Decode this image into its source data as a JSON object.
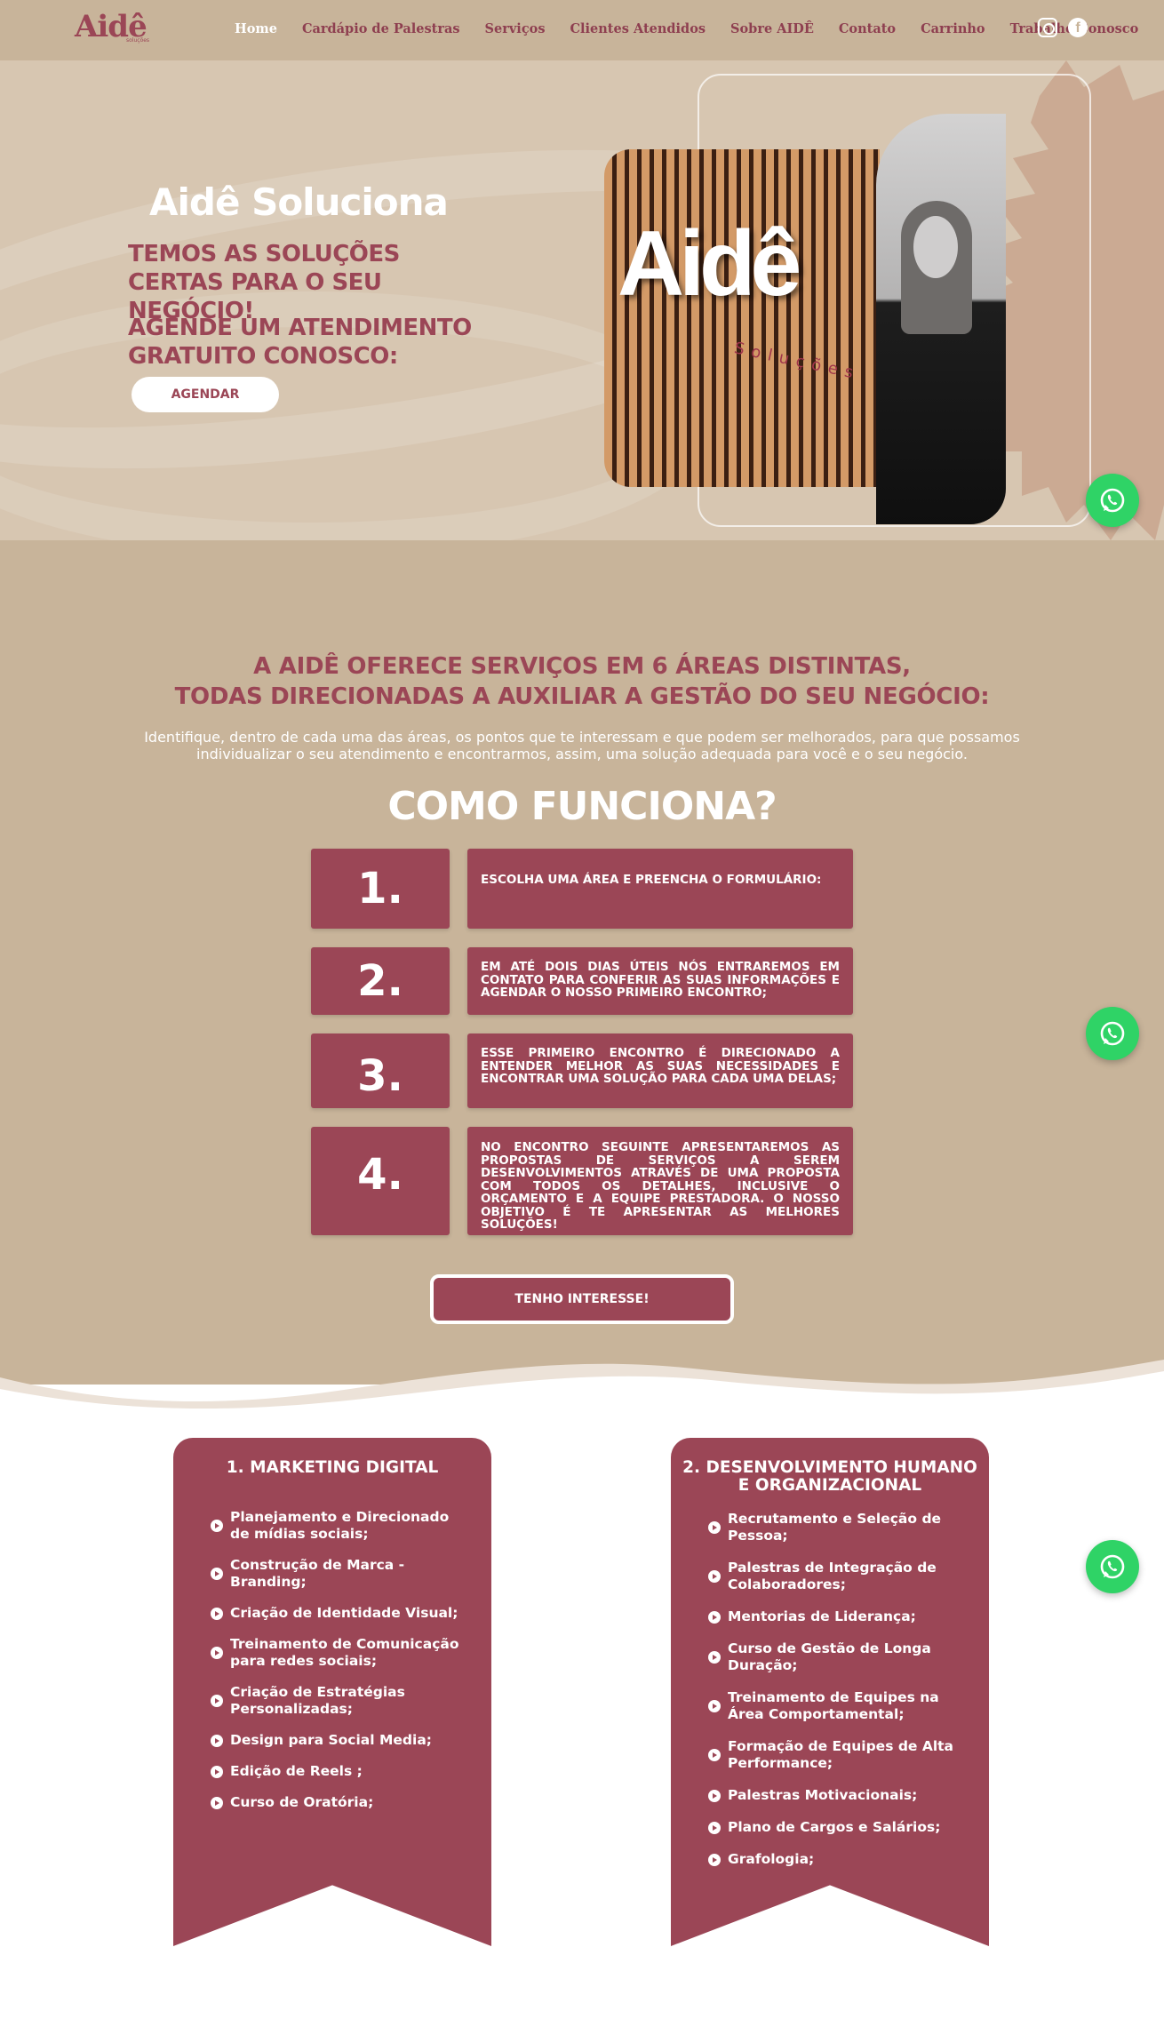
{
  "header": {
    "logo": "Aidê",
    "logo_sub": "soluções",
    "nav": [
      "Home",
      "Cardápio de Palestras",
      "Serviços",
      "Clientes Atendidos",
      "Sobre AIDÊ",
      "Contato",
      "Carrinho",
      "Trabalhe Conosco"
    ],
    "social": [
      "instagram-icon",
      "facebook-icon"
    ]
  },
  "hero": {
    "title": "Aidê Soluciona",
    "subtitle1": "TEMOS AS SOLUÇÕES CERTAS PARA O SEU NEGÓCIO!",
    "subtitle2": "AGENDE UM ATENDIMENTO GRATUITO CONOSCO:",
    "button": "AGENDAR",
    "image_logo": "Aidê",
    "image_logo_sub": "Soluções"
  },
  "areas": {
    "title_line1": "A AIDÊ OFERECE SERVIÇOS EM 6 ÁREAS DISTINTAS,",
    "title_line2": "TODAS DIRECIONADAS A AUXILIAR A GESTÃO DO SEU NEGÓCIO:",
    "description": "Identifique, dentro de cada uma das áreas, os pontos que te interessam e que podem ser melhorados, para que possamos individualizar o seu atendimento e encontrarmos, assim, uma solução adequada para você e o seu negócio."
  },
  "como_funciona": {
    "title": "COMO FUNCIONA?",
    "steps": [
      {
        "num": "1.",
        "text": "ESCOLHA UMA ÁREA E PREENCHA O FORMULÁRIO:"
      },
      {
        "num": "2.",
        "text": "EM ATÉ DOIS DIAS ÚTEIS NÓS ENTRAREMOS EM CONTATO PARA CONFERIR AS SUAS INFORMAÇÕES E AGENDAR O NOSSO PRIMEIRO ENCONTRO;"
      },
      {
        "num": "3.",
        "text": "ESSE PRIMEIRO ENCONTRO É DIRECIONADO A ENTENDER MELHOR AS SUAS NECESSIDADES E ENCONTRAR UMA SOLUÇÃO PARA CADA UMA DELAS;"
      },
      {
        "num": "4.",
        "text": "NO ENCONTRO SEGUINTE APRESENTAREMOS AS PROPOSTAS DE SERVIÇOS A SEREM DESENVOLVIMENTOS ATRAVÉS DE UMA PROPOSTA COM TODOS OS DETALHES, INCLUSIVE O ORÇAMENTO E A EQUIPE PRESTADORA. O NOSSO OBJETIVO É TE APRESENTAR AS MELHORES SOLUÇÕES!"
      }
    ],
    "button": "TENHO INTERESSE!"
  },
  "services": [
    {
      "title": "1. MARKETING DIGITAL",
      "items": [
        "Planejamento e Direcionado de mídias sociais;",
        "Construção de Marca - Branding;",
        "Criação de Identidade Visual;",
        "Treinamento de Comunicação para redes sociais;",
        "Criação de Estratégias Personalizadas;",
        "Design para Social Media;",
        "Edição de Reels ;",
        "Curso de Oratória;"
      ]
    },
    {
      "title": "2. DESENVOLVIMENTO HUMANO E ORGANIZACIONAL",
      "items": [
        "Recrutamento e Seleção de Pessoa;",
        "Palestras de Integração de Colaboradores;",
        "Mentorias de Liderança;",
        "Curso de Gestão de Longa Duração;",
        "Treinamento de Equipes na Área Comportamental;",
        "Formação de Equipes de Alta Performance;",
        "Palestras Motivacionais;",
        "Plano de Cargos e Salários;",
        "Grafologia;"
      ]
    }
  ],
  "colors": {
    "brand": "#9b4656",
    "tan": "#c8b49a",
    "whatsapp": "#2fd366"
  }
}
